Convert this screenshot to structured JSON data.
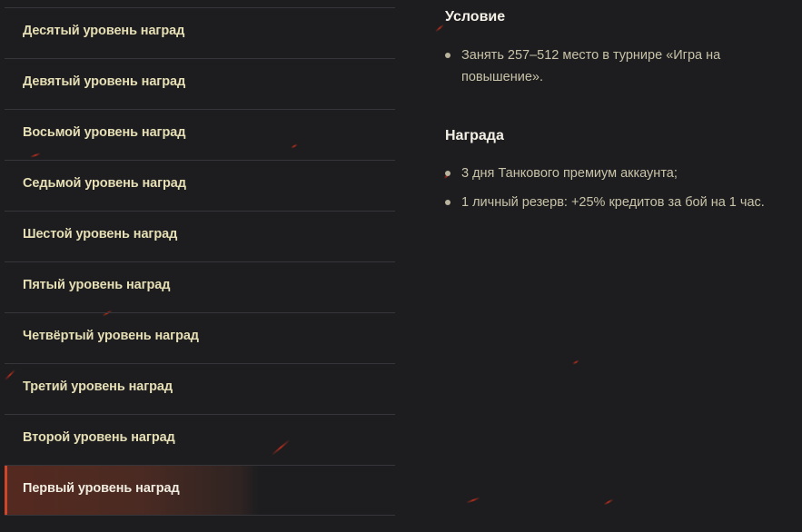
{
  "tiers": [
    {
      "label": "Десятый уровень наград"
    },
    {
      "label": "Девятый уровень наград"
    },
    {
      "label": "Восьмой уровень наград"
    },
    {
      "label": "Седьмой уровень наград"
    },
    {
      "label": "Шестой уровень наград"
    },
    {
      "label": "Пятый уровень наград"
    },
    {
      "label": "Четвёртый уровень наград"
    },
    {
      "label": "Третий уровень наград"
    },
    {
      "label": "Второй уровень наград"
    },
    {
      "label": "Первый уровень наград"
    }
  ],
  "selected_tier": "Первый уровень наград",
  "condition": {
    "title": "Условие",
    "items": [
      "Занять 257–512 место в турнире «Игра на повышение»."
    ]
  },
  "reward": {
    "title": "Награда",
    "items": [
      "3 дня Танкового премиум аккаунта;",
      "1 личный резерв: +25% кредитов за бой на 1 час."
    ]
  },
  "colors": {
    "background": "#1d1d20",
    "tier_text": "#e6dfb5",
    "active_tier_bg": "#55291f",
    "active_accent": "#d0452a",
    "heading_text": "#f4f0e6",
    "body_text": "#c8c3a8"
  }
}
